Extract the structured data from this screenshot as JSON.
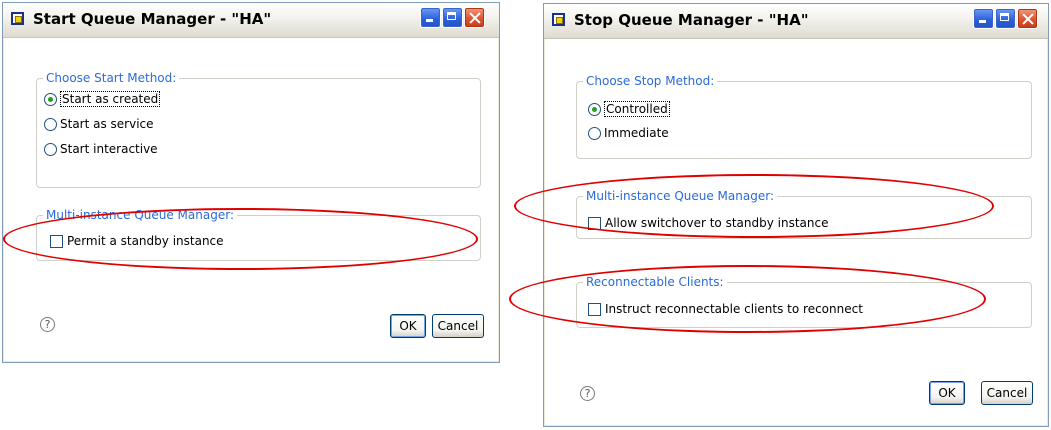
{
  "start_dialog": {
    "title": "Start Queue Manager - \"HA\"",
    "method_legend": "Choose Start Method:",
    "options": [
      {
        "label": "Start as created",
        "selected": true
      },
      {
        "label": "Start as service",
        "selected": false
      },
      {
        "label": "Start interactive",
        "selected": false
      }
    ],
    "multi_legend": "Multi-instance Queue Manager:",
    "standby_label": "Permit a standby instance",
    "standby_checked": false,
    "help": "?",
    "ok": "OK",
    "cancel": "Cancel"
  },
  "stop_dialog": {
    "title": "Stop Queue Manager - \"HA\"",
    "method_legend": "Choose Stop Method:",
    "options": [
      {
        "label": "Controlled",
        "selected": true
      },
      {
        "label": "Immediate",
        "selected": false
      }
    ],
    "multi_legend": "Multi-instance Queue Manager:",
    "switchover_label": "Allow switchover to standby instance",
    "switchover_checked": false,
    "reconnect_legend": "Reconnectable Clients:",
    "reconnect_label": "Instruct reconnectable clients to reconnect",
    "reconnect_checked": false,
    "help": "?",
    "ok": "OK",
    "cancel": "Cancel"
  },
  "colors": {
    "legend_text": "#2a6ad8",
    "callout": "#e00000",
    "selected_radio": "#21a121",
    "close_button": "#d9512e",
    "title_button": "#2a5fd8"
  }
}
